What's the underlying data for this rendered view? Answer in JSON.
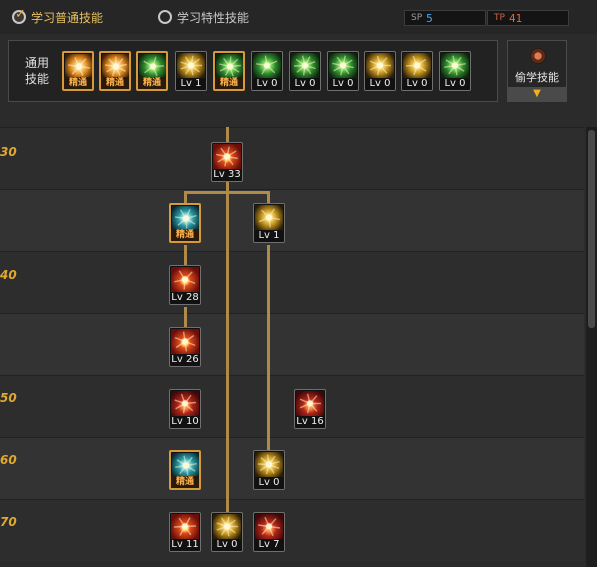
{
  "tabs": {
    "normal": {
      "label": "学习普通技能",
      "selected": true
    },
    "trait": {
      "label": "学习特性技能",
      "selected": false
    }
  },
  "sp": {
    "normal": {
      "caption": "SP",
      "value": "5",
      "color": "#4aa8f0"
    },
    "trait": {
      "caption": "TP",
      "value": "41",
      "color": "#f06030"
    }
  },
  "common": {
    "label": "通用技能",
    "skills": [
      {
        "level": "精通",
        "mastered": true,
        "icon": "sit-meditate-icon",
        "color": "orange"
      },
      {
        "level": "精通",
        "mastered": true,
        "icon": "swirl-strike-icon",
        "color": "orange"
      },
      {
        "level": "精通",
        "mastered": true,
        "icon": "leap-kick-icon",
        "color": "green"
      },
      {
        "level": "Lv 1",
        "mastered": false,
        "icon": "winged-emblem-icon",
        "color": "gold"
      },
      {
        "level": "精通",
        "mastered": true,
        "icon": "target-sigil-icon",
        "color": "green"
      },
      {
        "level": "Lv 0",
        "mastered": false,
        "icon": "crosshair-icon",
        "color": "green"
      },
      {
        "level": "Lv 0",
        "mastered": false,
        "icon": "charging-figure-icon",
        "color": "green"
      },
      {
        "level": "Lv 0",
        "mastered": false,
        "icon": "rising-figure-icon",
        "color": "green"
      },
      {
        "level": "Lv 0",
        "mastered": false,
        "icon": "eye-swirl-icon",
        "color": "gold"
      },
      {
        "level": "Lv 0",
        "mastered": false,
        "icon": "golden-aura-icon",
        "color": "gold"
      },
      {
        "level": "Lv 0",
        "mastered": false,
        "icon": "kneeling-figure-icon",
        "color": "green"
      }
    ]
  },
  "steal": {
    "label": "偷学技能",
    "icon": "steal-orb-icon"
  },
  "level_markers": [
    "30",
    "40",
    "50",
    "60",
    "70"
  ],
  "tree": {
    "skills": [
      {
        "id": "burst-strike",
        "level": "Lv 33",
        "mastered": false,
        "icon": "explosion-burst-icon",
        "color": "red"
      },
      {
        "id": "ice-claw",
        "level": "精通",
        "mastered": true,
        "icon": "ice-claw-icon",
        "color": "teal"
      },
      {
        "id": "tornado",
        "level": "Lv 1",
        "mastered": false,
        "icon": "tornado-icon",
        "color": "gold"
      },
      {
        "id": "fire-pillar",
        "level": "Lv 28",
        "mastered": false,
        "icon": "fire-pillar-icon",
        "color": "red"
      },
      {
        "id": "flame-blast",
        "level": "Lv 26",
        "mastered": false,
        "icon": "flame-blast-icon",
        "color": "red"
      },
      {
        "id": "fire-slash",
        "level": "Lv 10",
        "mastered": false,
        "icon": "fire-slash-icon",
        "color": "dred"
      },
      {
        "id": "summon-ghoul",
        "level": "Lv 16",
        "mastered": false,
        "icon": "summon-ghoul-icon",
        "color": "dred"
      },
      {
        "id": "spirit-rise",
        "level": "精通",
        "mastered": true,
        "icon": "spirit-rise-icon",
        "color": "teal"
      },
      {
        "id": "golden-burst",
        "level": "Lv 0",
        "mastered": false,
        "icon": "golden-burst-icon",
        "color": "gold"
      },
      {
        "id": "red-nova",
        "level": "Lv 11",
        "mastered": false,
        "icon": "red-nova-icon",
        "color": "red"
      },
      {
        "id": "gold-flare",
        "level": "Lv 0",
        "mastered": false,
        "icon": "gold-flare-icon",
        "color": "gold"
      },
      {
        "id": "hooded-mage",
        "level": "Lv 7",
        "mastered": false,
        "icon": "hooded-mage-icon",
        "color": "dred"
      }
    ]
  },
  "colors": {
    "accent": "#e8c060",
    "tree_line": "#b08a48",
    "level_marker": "#e0a830",
    "mastered_border": "#d69a3c"
  }
}
